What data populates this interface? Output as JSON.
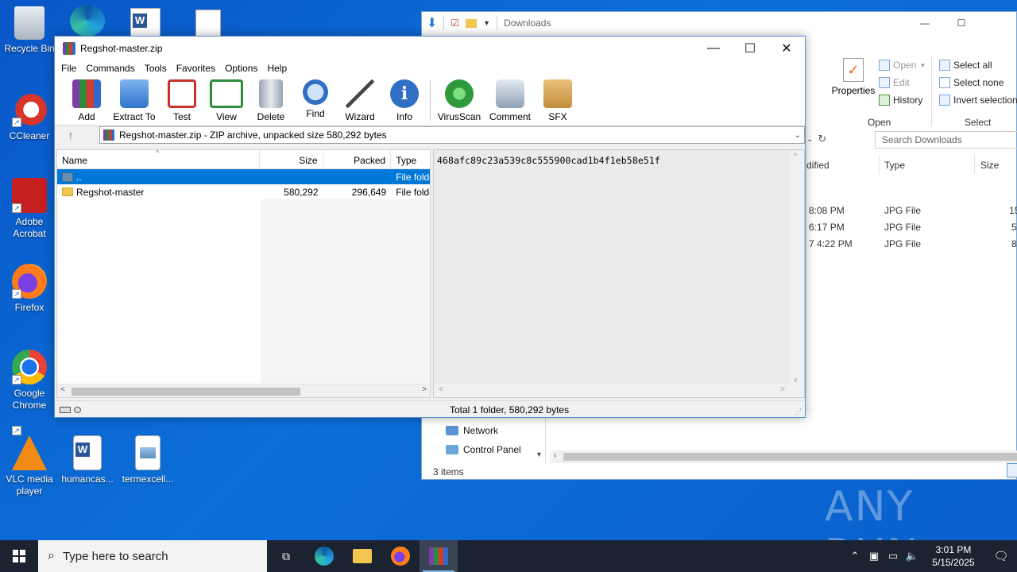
{
  "desktop": {
    "icons": [
      {
        "label": "Recycle Bin",
        "icon": "recycle-bin-icon"
      },
      {
        "label": "CCleaner",
        "icon": "ccleaner-icon"
      },
      {
        "label": "Adobe Acrobat",
        "icon": "acrobat-icon"
      },
      {
        "label": "Firefox",
        "icon": "firefox-icon"
      },
      {
        "label": "Google Chrome",
        "icon": "chrome-icon"
      },
      {
        "label": "VLC media player",
        "icon": "vlc-icon"
      },
      {
        "label": "humancas...",
        "icon": "word-doc-icon"
      },
      {
        "label": "termexcell...",
        "icon": "image-file-icon"
      }
    ]
  },
  "explorer": {
    "qat_title": "Downloads",
    "ribbon": {
      "properties": "Properties",
      "open": "Open",
      "edit": "Edit",
      "history": "History",
      "open_group": "Open",
      "select_all": "Select all",
      "select_none": "Select none",
      "invert_selection": "Invert selection",
      "select_group": "Select"
    },
    "search_placeholder": "Search Downloads",
    "columns": {
      "modified": "dified",
      "type": "Type",
      "size": "Size"
    },
    "rows": [
      {
        "modified": "8:08 PM",
        "type": "JPG File",
        "size": "15"
      },
      {
        "modified": "6:17 PM",
        "type": "JPG File",
        "size": "5"
      },
      {
        "modified": "7 4:22 PM",
        "type": "JPG File",
        "size": "8"
      }
    ],
    "nav": [
      {
        "label": "Network"
      },
      {
        "label": "Control Panel"
      }
    ],
    "status": "3 items"
  },
  "winrar": {
    "title": "Regshot-master.zip",
    "menu": [
      "File",
      "Commands",
      "Tools",
      "Favorites",
      "Options",
      "Help"
    ],
    "toolbar": [
      {
        "label": "Add",
        "icon": "add-archive-icon",
        "color": "#c0392b"
      },
      {
        "label": "Extract To",
        "icon": "extract-folder-icon",
        "color": "#3d7fd8"
      },
      {
        "label": "Test",
        "icon": "test-clipboard-icon",
        "color": "#c9302c"
      },
      {
        "label": "View",
        "icon": "view-book-icon",
        "color": "#2e8b3b"
      },
      {
        "label": "Delete",
        "icon": "trash-icon",
        "color": "#7b8a99"
      },
      {
        "label": "Find",
        "icon": "magnifier-icon",
        "color": "#2f6fc4"
      },
      {
        "label": "Wizard",
        "icon": "magic-wand-icon",
        "color": "#8e5ab8"
      },
      {
        "label": "Info",
        "icon": "info-icon",
        "color": "#2f6fc4"
      },
      {
        "label": "VirusScan",
        "icon": "virus-scan-icon",
        "color": "#2e9a3b"
      },
      {
        "label": "Comment",
        "icon": "comment-icon",
        "color": "#7d8fa6"
      },
      {
        "label": "SFX",
        "icon": "sfx-box-icon",
        "color": "#d0a050"
      }
    ],
    "path": "Regshot-master.zip - ZIP archive, unpacked size 580,292 bytes",
    "columns": {
      "name": "Name",
      "size": "Size",
      "packed": "Packed",
      "type": "Type"
    },
    "files": [
      {
        "name": "..",
        "size": "",
        "packed": "",
        "type": "File folder"
      },
      {
        "name": "Regshot-master",
        "size": "580,292",
        "packed": "296,649",
        "type": "File folder"
      }
    ],
    "comment": "468afc89c23a539c8c555900cad1b4f1eb58e51f",
    "status": "Total 1 folder, 580,292 bytes"
  },
  "taskbar": {
    "search_placeholder": "Type here to search",
    "time": "3:01 PM",
    "date": "5/15/2025"
  },
  "watermark": "ANY RUN"
}
